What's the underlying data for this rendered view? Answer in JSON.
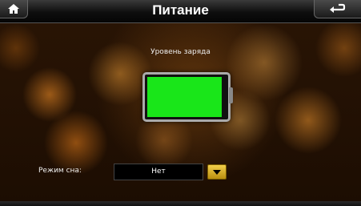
{
  "header": {
    "title": "Питание",
    "home_icon": "home-icon",
    "back_icon": "back-arrow-icon"
  },
  "battery": {
    "label": "Уровень заряда",
    "level_fraction": 0.95,
    "fill_color": "#19e619"
  },
  "sleep_mode": {
    "label": "Режим сна:",
    "value": "Нет",
    "dropdown_icon": "chevron-down-icon",
    "accent_color": "#e0b020"
  }
}
